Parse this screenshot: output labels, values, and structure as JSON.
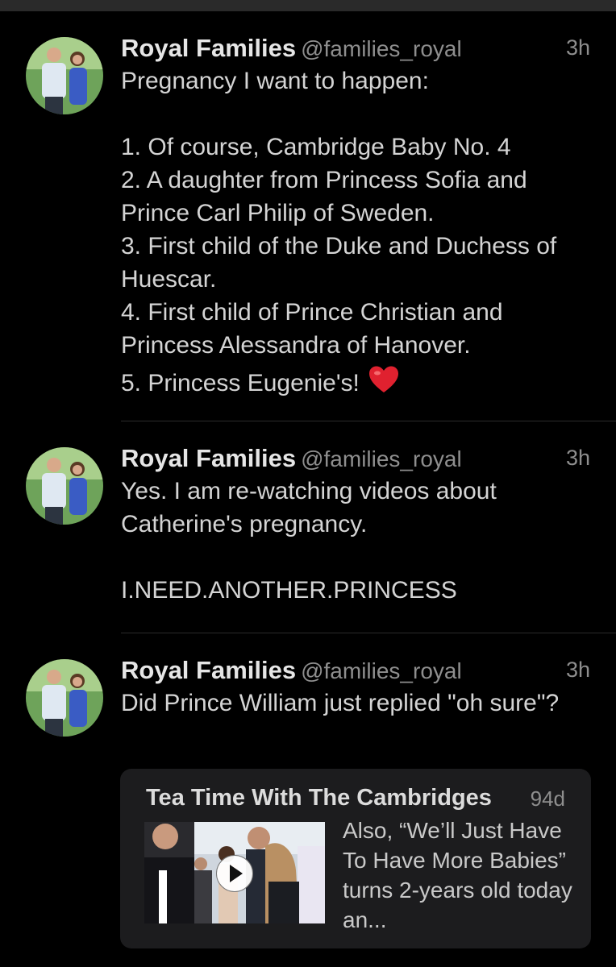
{
  "tweets": [
    {
      "name": "Royal Families",
      "handle": "@families_royal",
      "time": "3h",
      "text": "Pregnancy I want to happen:\n\n1. Of course, Cambridge Baby No. 4\n2. A daughter from Princess Sofia and Prince Carl Philip of Sweden.\n3. First child of the Duke and Duchess of Huescar.\n4. First child of Prince Christian and Princess Alessandra of Hanover.\n5. Princess Eugenie's!"
    },
    {
      "name": "Royal Families",
      "handle": "@families_royal",
      "time": "3h",
      "text": "Yes. I am re-watching videos about Catherine's pregnancy.\n\nI.NEED.ANOTHER.PRINCESS"
    },
    {
      "name": "Royal Families",
      "handle": "@families_royal",
      "time": "3h",
      "text": "Did Prince William just replied \"oh sure\"?"
    }
  ],
  "quoted": {
    "title": "Tea Time With The Cambridges",
    "time": "94d",
    "text": "Also, “We’ll Just Have To Have More Babies” turns 2-years old today an..."
  },
  "icons": [
    "heart-emoji-icon",
    "play-icon"
  ],
  "colors": {
    "background": "#000000",
    "card": "#1c1c1e",
    "heart": "#e0212f"
  }
}
